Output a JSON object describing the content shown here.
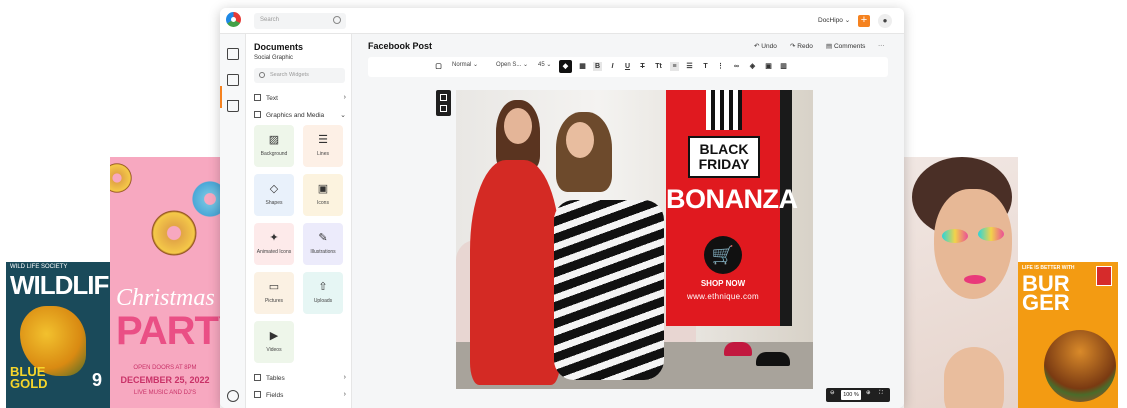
{
  "app": {
    "search_placeholder": "Search",
    "account": "DocHipo ⌄",
    "user_icon": "user-icon",
    "accent": "#f5821f"
  },
  "panel": {
    "title": "Documents",
    "subtitle": "Social Graphic",
    "search_placeholder": "Search Widgets",
    "sections": {
      "text": "Text",
      "graphics": "Graphics and Media",
      "tables": "Tables",
      "fields": "Fields"
    },
    "tiles": [
      {
        "label": "Background",
        "icon": "background-icon"
      },
      {
        "label": "Lines",
        "icon": "lines-icon"
      },
      {
        "label": "Shapes",
        "icon": "shapes-icon"
      },
      {
        "label": "Icons",
        "icon": "icons-icon"
      },
      {
        "label": "Animated Icons",
        "icon": "animated-icon"
      },
      {
        "label": "Illustrations",
        "icon": "illustration-icon"
      },
      {
        "label": "Pictures",
        "icon": "picture-icon"
      },
      {
        "label": "Uploads",
        "icon": "upload-icon"
      },
      {
        "label": "Videos",
        "icon": "video-icon"
      }
    ]
  },
  "canvas": {
    "title": "Facebook Post",
    "undo": "Undo",
    "redo": "Redo",
    "comments": "Comments",
    "more": "···",
    "zoom": "100 %"
  },
  "toolbar": {
    "style": "Normal",
    "font": "Open S...",
    "size": "45"
  },
  "design": {
    "headline1": "BLACK",
    "headline2": "FRIDAY",
    "headline3": "BONANZA",
    "cta": "SHOP NOW",
    "url": "www.ethnique.com"
  },
  "templates": {
    "wild": {
      "top": "WILD LIFE SOCIETY",
      "title": "WILDLIFE",
      "blue": "BLUE",
      "gold": "GOLD",
      "nine": "9"
    },
    "xmas": {
      "christmas": "Christmas",
      "party": "PARTY",
      "open": "OPEN DOORS AT 8PM",
      "date": "DECEMBER 25, 2022",
      "music": "LIVE MUSIC AND DJ'S"
    },
    "burger": {
      "top": "LIFE IS BETTER WITH",
      "title": "BUR GER"
    }
  }
}
